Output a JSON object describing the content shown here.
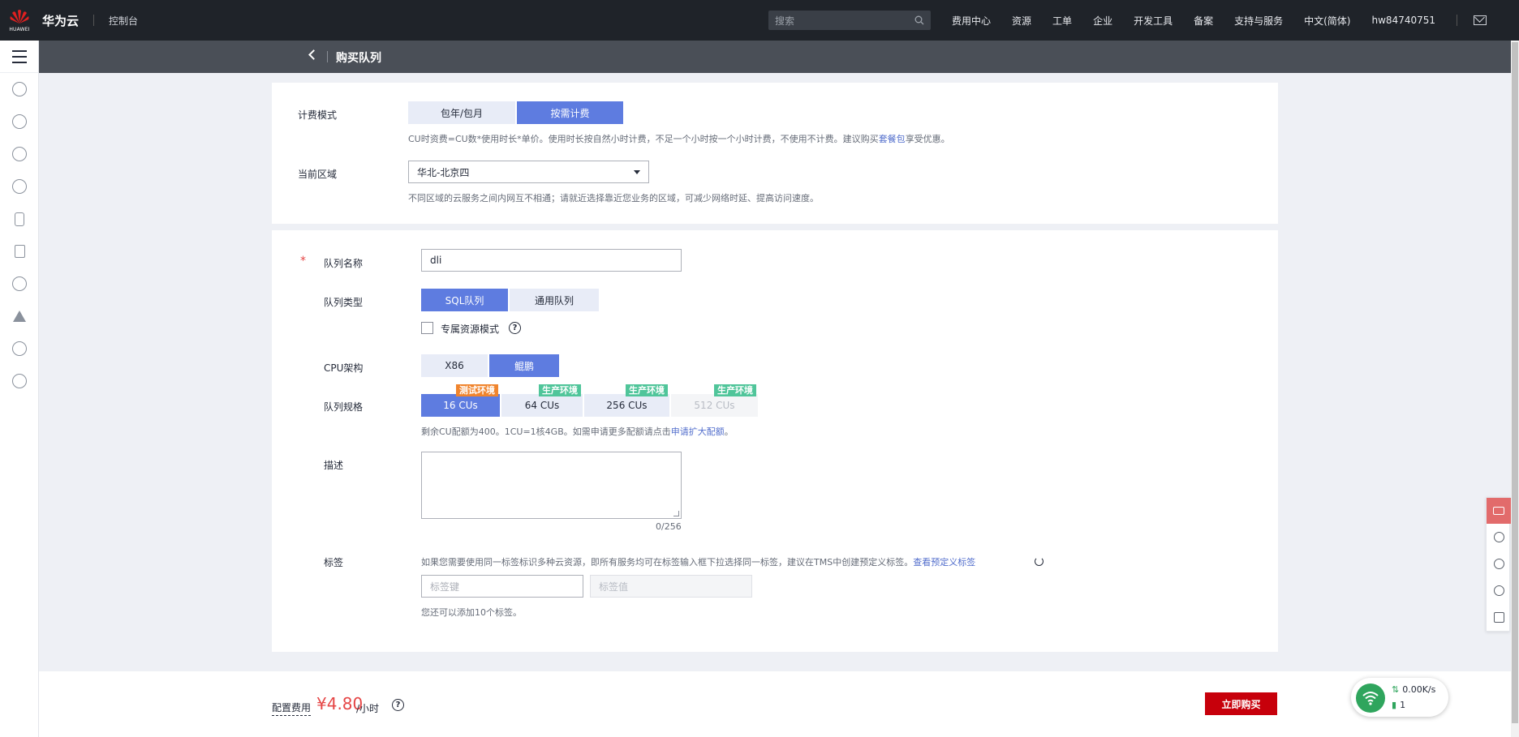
{
  "topbar": {
    "logo_sub": "HUAWEI",
    "brand": "华为云",
    "console": "控制台",
    "search_placeholder": "搜索",
    "nav": [
      "费用中心",
      "资源",
      "工单",
      "企业",
      "开发工具",
      "备案",
      "支持与服务",
      "中文(简体)",
      "hw84740751"
    ]
  },
  "sidebar": {
    "icons": [
      "cloud-icon",
      "cluster-icon",
      "network-icon",
      "storage-icon",
      "device-icon",
      "document-icon",
      "cloud-sync-icon",
      "deploy-icon",
      "globe-icon",
      "service-icon"
    ]
  },
  "header": {
    "title": "购买队列"
  },
  "billing": {
    "label": "计费模式",
    "options": [
      "包年/包月",
      "按需计费"
    ],
    "active_index": 1,
    "hint_text": "CU时资费=CU数*使用时长*单价。使用时长按自然小时计费，不足一个小时按一个小时计费，不使用不计费。建议购买",
    "hint_link": "套餐包",
    "hint_suffix": "享受优惠。"
  },
  "region": {
    "label": "当前区域",
    "value": "华北-北京四",
    "hint": "不同区域的云服务之间内网互不相通；请就近选择靠近您业务的区域，可减少网络时延、提高访问速度。"
  },
  "queue": {
    "required_mark": "*",
    "name_label": "队列名称",
    "name_value": "dli",
    "type_label": "队列类型",
    "type_options": [
      "SQL队列",
      "通用队列"
    ],
    "type_active_index": 0,
    "dedicated_label": "专属资源模式",
    "help_glyph": "?",
    "cpu_label": "CPU架构",
    "cpu_options": [
      "X86",
      "鲲鹏"
    ],
    "cpu_active_index": 1,
    "spec_label": "队列规格",
    "specs": [
      {
        "label": "16 CUs",
        "badge": "测试环境",
        "state": "active"
      },
      {
        "label": "64 CUs",
        "badge": "生产环境",
        "state": "normal"
      },
      {
        "label": "256 CUs",
        "badge": "生产环境",
        "state": "normal"
      },
      {
        "label": "512 CUs",
        "badge": "生产环境",
        "state": "disabled"
      }
    ],
    "spec_hint_text": "剩余CU配额为400。1CU=1核4GB。如需申请更多配额请点击",
    "spec_hint_link": "申请扩大配额",
    "spec_hint_suffix": "。",
    "desc_label": "描述",
    "desc_value": "",
    "desc_count": "0/256",
    "tag_label": "标签",
    "tag_hint_text": "如果您需要使用同一标签标识多种云资源，即所有服务均可在标签输入框下拉选择同一标签，建议在TMS中创建预定义标签。",
    "tag_hint_link": "查看预定义标签",
    "tag_key_placeholder": "标签键",
    "tag_value_placeholder": "标签值",
    "tag_remaining": "您还可以添加10个标签。"
  },
  "footer": {
    "fee_label": "配置费用",
    "price": "¥4.80",
    "unit": "/小时",
    "buy_button": "立即购买"
  },
  "network_widget": {
    "speed": "0.00K/s",
    "count": "1"
  },
  "colors": {
    "accent": "#5e7ce0",
    "buy": "#c7000b",
    "price": "#e54545",
    "badge_test": "#f0842d",
    "badge_prod": "#50c59a"
  }
}
